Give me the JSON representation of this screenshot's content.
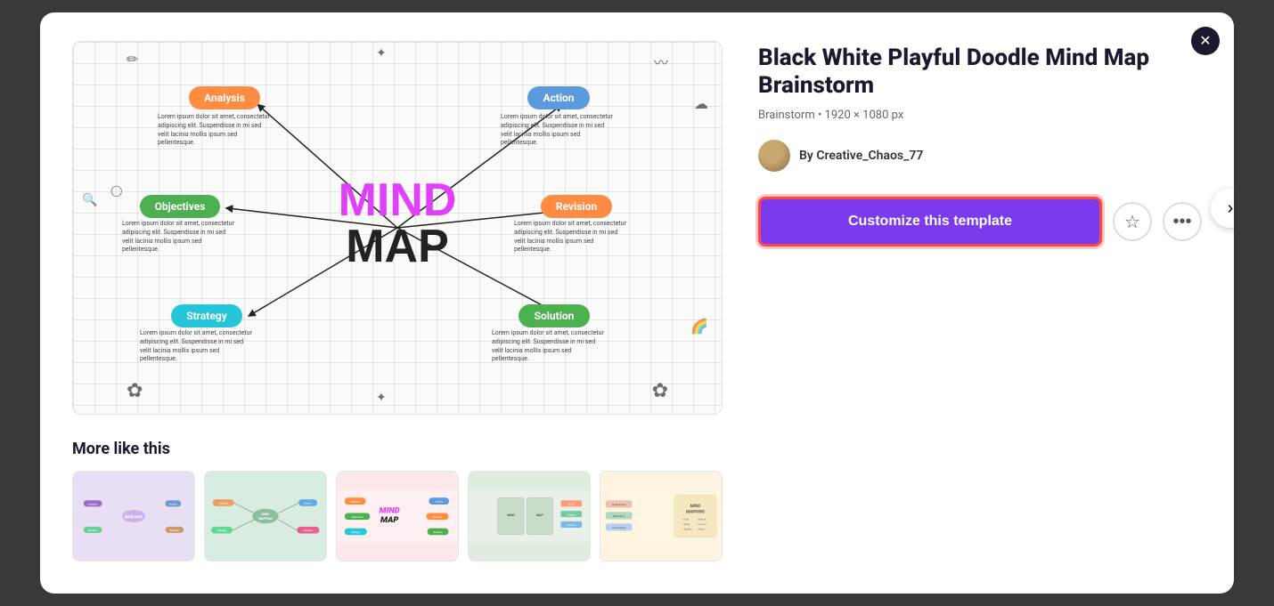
{
  "modal": {
    "close_label": "✕"
  },
  "template": {
    "title": "Black White Playful Doodle Mind Map Brainstorm",
    "meta": "Brainstorm • 1920 × 1080 px",
    "author_prefix": "By",
    "author_name": "Creative_Chaos_77",
    "customize_btn": "Customize this template",
    "star_icon": "☆",
    "more_icon": "•••"
  },
  "more_like_this": {
    "label": "More like this",
    "thumbnails": [
      {
        "alt": "Purple mind map template"
      },
      {
        "alt": "Green mind mapping template"
      },
      {
        "alt": "Colorful mind map template"
      },
      {
        "alt": "Notebook style mind map"
      },
      {
        "alt": "Pastel mind mapping template"
      }
    ]
  },
  "mind_map": {
    "title_line1": "MIND",
    "title_line2": "MAP",
    "nodes": [
      {
        "label": "Analysis",
        "color": "orange"
      },
      {
        "label": "Action",
        "color": "blue"
      },
      {
        "label": "Objectives",
        "color": "green"
      },
      {
        "label": "Revision",
        "color": "orange"
      },
      {
        "label": "Strategy",
        "color": "teal"
      },
      {
        "label": "Solution",
        "color": "green"
      }
    ],
    "lorem_text": "Lorem ipsum dolor sit amet, consectetur adipiscing elit. Suspendisse in mi sed velit lacinia mollis ipsum sed pellentesque."
  },
  "nav": {
    "next_arrow": "›"
  }
}
